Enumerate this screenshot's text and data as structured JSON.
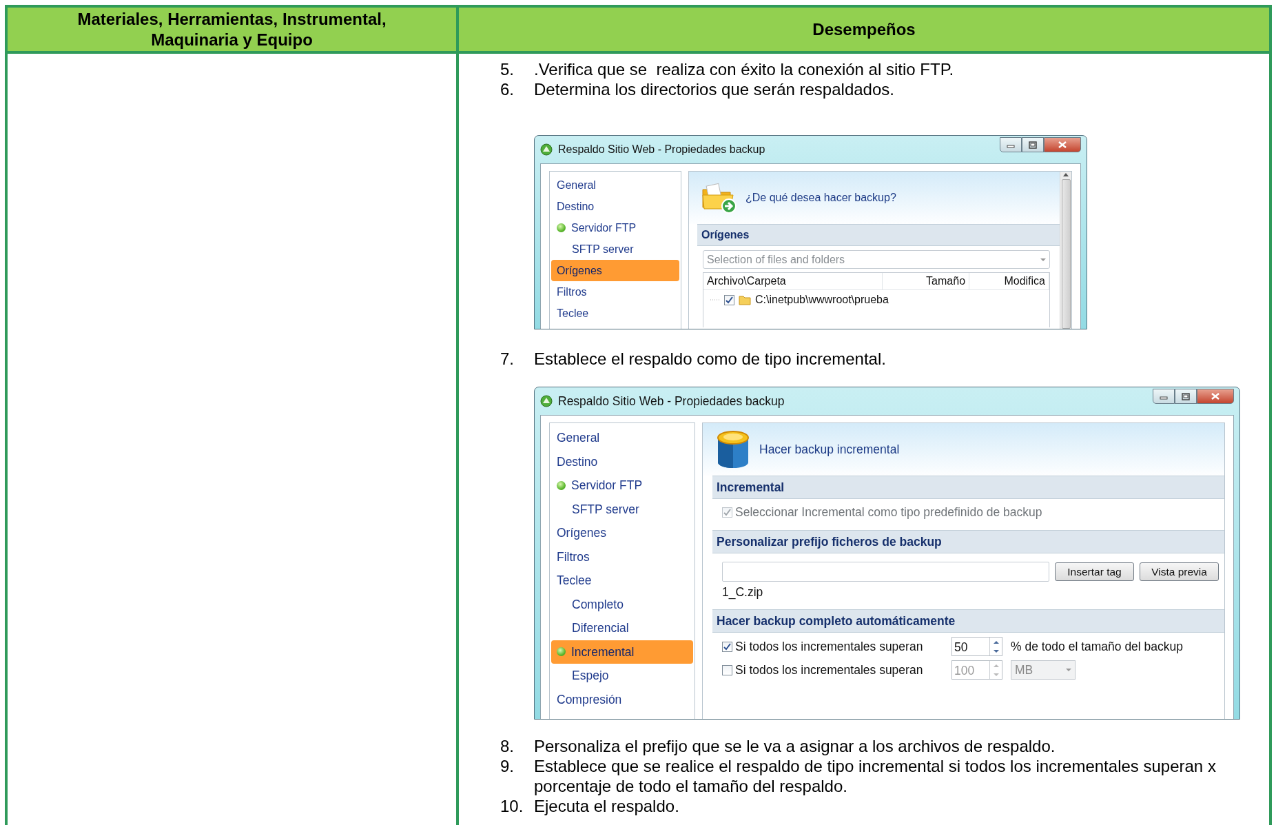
{
  "table": {
    "columns": [
      "Materiales, Herramientas, Instrumental, Maquinaria y Equipo",
      "Desempeños"
    ]
  },
  "content": [
    {
      "kind": "step",
      "number": "5.",
      "text": ".Verifica que se  realiza con éxito la conexión al sitio FTP."
    },
    {
      "kind": "step",
      "number": "6.",
      "text": "Determina los directorios que serán respaldados."
    },
    {
      "kind": "window",
      "title": "Respaldo Sitio Web - Propiedades backup",
      "heading": "¿De qué desea hacer backup?",
      "nav": [
        {
          "label": "General",
          "selected": false,
          "dot": false
        },
        {
          "label": "Destino",
          "selected": false,
          "dot": false
        },
        {
          "label": "Servidor FTP",
          "selected": false,
          "dot": true,
          "children": [
            {
              "label": "SFTP server",
              "selected": false,
              "dot": false
            }
          ]
        },
        {
          "label": "Orígenes",
          "selected": true,
          "dot": false
        },
        {
          "label": "Filtros",
          "selected": false,
          "dot": false
        },
        {
          "label": "Teclee",
          "selected": false,
          "dot": false
        }
      ],
      "sections": [
        {
          "kind": "sources",
          "title": "Orígenes",
          "dropdown": "Selection of files and folders",
          "columns": [
            "Archivo\\Carpeta",
            "Tamaño",
            "Modifica"
          ],
          "rows": [
            {
              "checked": true,
              "path": "C:\\inetpub\\wwwroot\\prueba"
            }
          ]
        }
      ]
    },
    {
      "kind": "step",
      "number": "7.",
      "text": "Establece el respaldo como de tipo incremental."
    },
    {
      "kind": "window",
      "title": "Respaldo Sitio Web - Propiedades backup",
      "heading": "Hacer backup incremental",
      "nav": [
        {
          "label": "General",
          "selected": false,
          "dot": false
        },
        {
          "label": "Destino",
          "selected": false,
          "dot": false
        },
        {
          "label": "Servidor FTP",
          "selected": false,
          "dot": true,
          "children": [
            {
              "label": "SFTP server",
              "selected": false,
              "dot": false
            }
          ]
        },
        {
          "label": "Orígenes",
          "selected": false,
          "dot": false
        },
        {
          "label": "Filtros",
          "selected": false,
          "dot": false
        },
        {
          "label": "Teclee",
          "selected": false,
          "dot": false,
          "children": [
            {
              "label": "Completo",
              "selected": false,
              "dot": false
            },
            {
              "label": "Diferencial",
              "selected": false,
              "dot": false
            },
            {
              "label": "Incremental",
              "selected": true,
              "dot": true
            },
            {
              "label": "Espejo",
              "selected": false,
              "dot": false
            }
          ]
        },
        {
          "label": "Compresión",
          "selected": false,
          "dot": false
        }
      ],
      "sections": [
        {
          "kind": "checkbox",
          "title": "Incremental",
          "checkbox": {
            "label": "Seleccionar Incremental como tipo predefinido de backup",
            "checked": true,
            "disabled": true
          }
        },
        {
          "kind": "prefix",
          "title": "Personalizar prefijo ficheros de backup",
          "buttons": [
            "Insertar tag",
            "Vista previa"
          ],
          "preview": "1_C.zip"
        },
        {
          "kind": "auto",
          "title": "Hacer backup completo automáticamente",
          "rows": [
            {
              "label": "Si todos los incrementales superan",
              "checked": true,
              "value": "50",
              "disabled": false,
              "suffix": "% de todo el tamaño del backup"
            },
            {
              "label": "Si todos los incrementales superan",
              "checked": false,
              "value": "100",
              "disabled": true,
              "unit": "MB"
            }
          ]
        }
      ]
    },
    {
      "kind": "step",
      "number": "8.",
      "text": "Personaliza el prefijo que se le va a asignar a los archivos de respaldo."
    },
    {
      "kind": "step",
      "number": "9.",
      "text": "Establece que se realice el respaldo de tipo incremental si todos los incrementales superan x porcentaje de todo el tamaño del respaldo."
    },
    {
      "kind": "step",
      "number": "10.",
      "text": "Ejecuta el respaldo."
    }
  ]
}
